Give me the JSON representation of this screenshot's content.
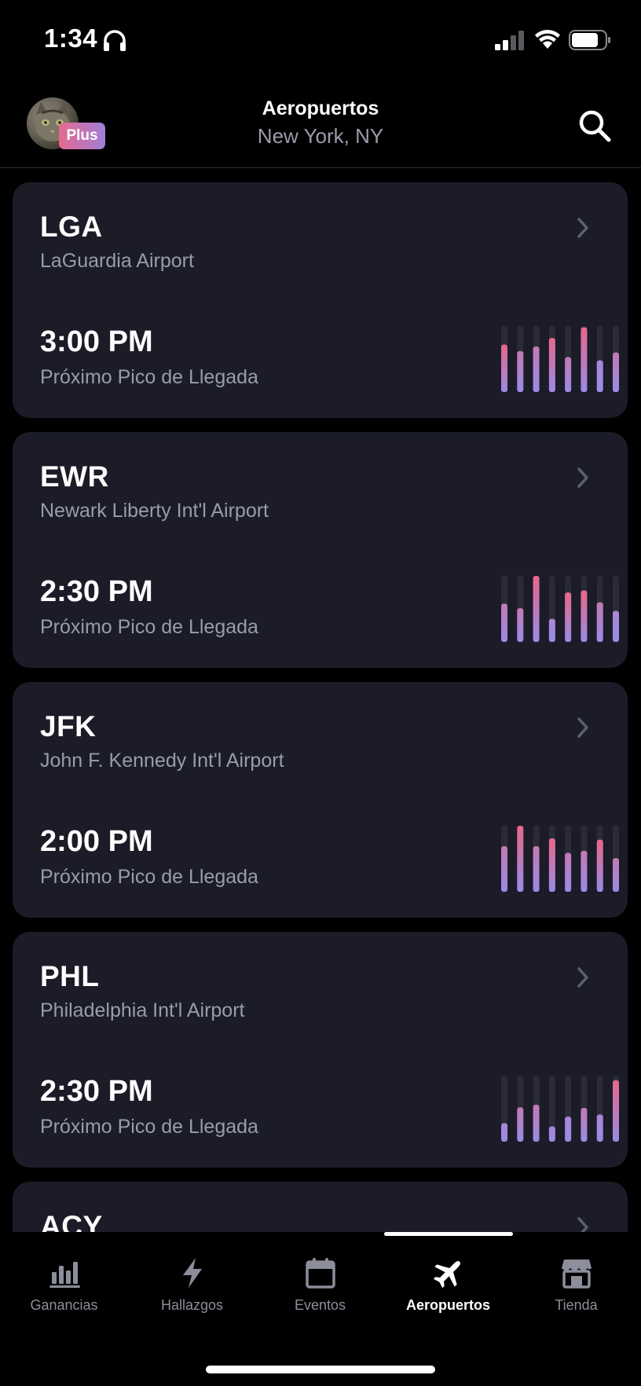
{
  "status": {
    "time": "1:34"
  },
  "header": {
    "title": "Aeropuertos",
    "subtitle": "New York, NY",
    "badge": "Plus"
  },
  "colors": {
    "bar_bottom": "#9a8be6",
    "bar_top": "#e8668b",
    "bar_track": "#2a2b37",
    "card_bg": "#1b1c27"
  },
  "airports": [
    {
      "code": "LGA",
      "name": "LaGuardia Airport",
      "peak_time": "3:00 PM",
      "peak_label": "Próximo Pico de Llegada",
      "levels": [
        0.72,
        0.62,
        0.69,
        0.82,
        0.53,
        0.98,
        0.48,
        0.6
      ]
    },
    {
      "code": "EWR",
      "name": "Newark Liberty Int'l Airport",
      "peak_time": "2:30 PM",
      "peak_label": "Próximo Pico de Llegada",
      "levels": [
        0.58,
        0.51,
        1.0,
        0.35,
        0.75,
        0.78,
        0.6,
        0.47
      ]
    },
    {
      "code": "JFK",
      "name": "John F. Kennedy Int'l Airport",
      "peak_time": "2:00 PM",
      "peak_label": "Próximo Pico de Llegada",
      "levels": [
        0.69,
        1.0,
        0.69,
        0.81,
        0.59,
        0.62,
        0.79,
        0.51
      ]
    },
    {
      "code": "PHL",
      "name": "Philadelphia Int'l Airport",
      "peak_time": "2:30 PM",
      "peak_label": "Próximo Pico de Llegada",
      "levels": [
        0.28,
        0.52,
        0.56,
        0.23,
        0.38,
        0.51,
        0.41,
        0.93
      ]
    },
    {
      "code": "ACY",
      "name": "",
      "peak_time": "",
      "peak_label": "",
      "levels": []
    }
  ],
  "tabs": [
    {
      "label": "Ganancias",
      "icon": "bar-chart-icon"
    },
    {
      "label": "Hallazgos",
      "icon": "lightning-icon"
    },
    {
      "label": "Eventos",
      "icon": "calendar-icon"
    },
    {
      "label": "Aeropuertos",
      "icon": "airplane-icon",
      "active": true
    },
    {
      "label": "Tienda",
      "icon": "store-icon"
    }
  ]
}
